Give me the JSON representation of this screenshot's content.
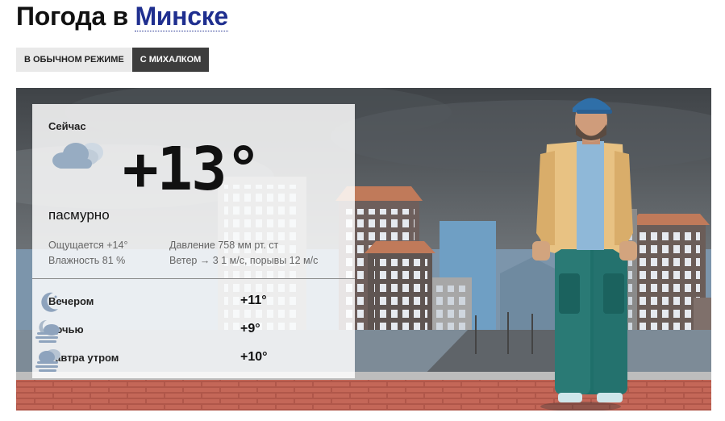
{
  "header": {
    "title_prefix": "Погода в",
    "city": "Минске"
  },
  "modes": [
    {
      "label": "в обычном режиме",
      "active": false
    },
    {
      "label": "с Михалком",
      "active": true
    }
  ],
  "current": {
    "label": "Сейчас",
    "temp": "+13°",
    "condition": "пасмурно",
    "icon": "cloudy-icon",
    "feels_like": "Ощущается +14°",
    "humidity": "Влажность 81 %",
    "pressure": "Давление 758 мм рт. ст",
    "wind": "Ветер → 3 1 м/с, порывы 12 м/с"
  },
  "forecast": [
    {
      "label": "Вечером",
      "temp": "+11°",
      "icon": "moon-clouds-icon"
    },
    {
      "label": "Ночью",
      "temp": "+9°",
      "icon": "cloud-fog-icon"
    },
    {
      "label": "Завтра утром",
      "temp": "+10°",
      "icon": "cloud-fog-icon"
    }
  ],
  "colors": {
    "city_link": "#1f2f8f",
    "active_mode": "#3d3d3d",
    "inactive_mode": "#e9e9e9"
  }
}
